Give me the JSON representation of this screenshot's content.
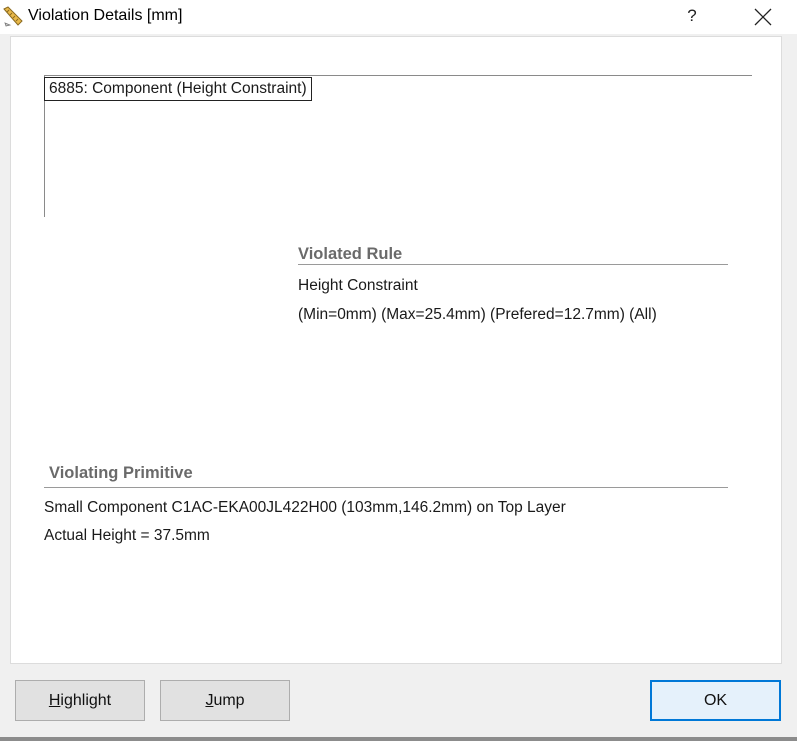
{
  "window": {
    "title": "Violation Details [mm]",
    "help_label": "?"
  },
  "tree": {
    "selected_item": "6885: Component (Height Constraint)"
  },
  "violated_rule": {
    "heading": "Violated Rule",
    "name": "Height Constraint",
    "details": "(Min=0mm) (Max=25.4mm) (Prefered=12.7mm) (All)"
  },
  "violating_primitive": {
    "heading": "Violating Primitive",
    "description": "Small Component C1AC-EKA00JL422H00 (103mm,146.2mm) on Top Layer",
    "measurement": "Actual Height = 37.5mm"
  },
  "buttons": {
    "highlight_mnemonic": "H",
    "highlight_rest": "ighlight",
    "jump_mnemonic": "J",
    "jump_rest": "ump",
    "ok": "OK"
  },
  "colors": {
    "accent": "#0078d7",
    "section_heading": "#6a6a6a"
  }
}
